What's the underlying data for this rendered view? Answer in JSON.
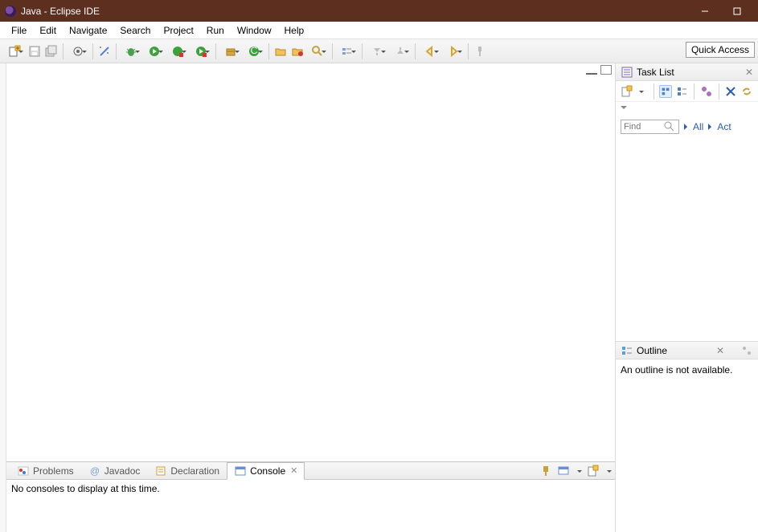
{
  "window": {
    "title": "Java - Eclipse IDE"
  },
  "menu": {
    "items": [
      "File",
      "Edit",
      "Navigate",
      "Search",
      "Project",
      "Run",
      "Window",
      "Help"
    ]
  },
  "toolbar": {
    "quick_access": "Quick Access"
  },
  "task_list": {
    "title": "Task List",
    "find_placeholder": "Find",
    "links": {
      "all": "All",
      "act": "Act"
    }
  },
  "outline": {
    "title": "Outline",
    "message": "An outline is not available."
  },
  "bottom_tabs": {
    "problems": "Problems",
    "javadoc": "Javadoc",
    "declaration": "Declaration",
    "console": "Console"
  },
  "console": {
    "message": "No consoles to display at this time."
  }
}
